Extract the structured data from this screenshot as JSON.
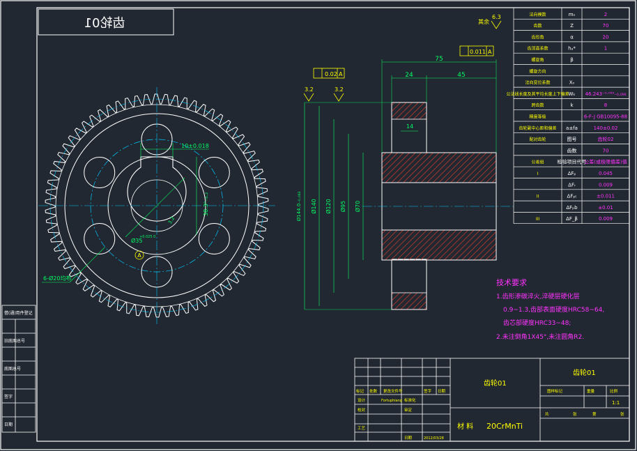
{
  "drawing": {
    "mirrored_title": "齿轮01",
    "colors": {
      "background": "#222831",
      "line": "#ffffff",
      "center_line": "#00c8ff",
      "dimension": "#00ff66",
      "hatch": "#c0392b",
      "text_yellow": "#ffff00",
      "text_magenta": "#ff33ff"
    },
    "front_view": {
      "keyway_width": "10±0.018",
      "keyway_depth": "38.3⁰₋₀.₂",
      "bore_dia": "Ø35",
      "bore_tol": "+0.025 0",
      "dim_small": "3.2",
      "holes_note": "6-Ø20均布",
      "datum": "A"
    },
    "section_view": {
      "length_total": "75",
      "length_hub": "24",
      "length_rim": "45",
      "width_web": "14",
      "dia_tip": "Ø144.0₋₀.₀₆₃",
      "dia_140": "Ø140",
      "dia_120": "Ø120",
      "dia_95": "Ø95",
      "dia_70": "Ø70",
      "roughness_1": "3.2",
      "roughness_2": "3.2",
      "roughness_corner": "6.3",
      "roughness_rest": "其余",
      "tol_box_1": "0.02",
      "tol_box_1_datum": "A",
      "tol_box_2": "0.011",
      "tol_box_2_datum": "A"
    },
    "param_table": [
      {
        "name": "法向模数",
        "sym": "mₙ",
        "val": "2"
      },
      {
        "name": "齿数",
        "sym": "Z",
        "val": "70"
      },
      {
        "name": "齿形角",
        "sym": "α",
        "val": "20"
      },
      {
        "name": "齿顶高系数",
        "sym": "hₐ*",
        "val": "1"
      },
      {
        "name": "螺旋角",
        "sym": "β",
        "val": ""
      },
      {
        "name": "螺旋方向",
        "sym": "",
        "val": ""
      },
      {
        "name": "法向变位系数",
        "sym": "Xₙ",
        "val": ""
      },
      {
        "name": "公法线长度及其平均长度上下偏差",
        "sym": "Wₖ",
        "val": "46.243⁻⁰·⁰⁵⁹₋₀.₀₉₆"
      },
      {
        "name": "跨齿数",
        "sym": "k",
        "val": "8"
      },
      {
        "name": "精度等级",
        "sym": "",
        "val": "6-F-J GB10095-88"
      },
      {
        "name": "齿轮副中心距和偏差",
        "sym": "a±fa",
        "val": "140±0.02"
      },
      {
        "name": "配对齿轮",
        "sym": "图号",
        "val": "齿轮02"
      },
      {
        "name": "",
        "sym": "齿数",
        "val": "70"
      },
      {
        "name": "公差组",
        "sym": "检验项目代号",
        "val": "公差(或极限偏差)值"
      },
      {
        "name": "I",
        "sym": "ΔFₚ",
        "val": "0.045"
      },
      {
        "name": "",
        "sym": "ΔFᵣ",
        "val": "0.009"
      },
      {
        "name": "II",
        "sym": "ΔFₚₜ",
        "val": "±0.011"
      },
      {
        "name": "",
        "sym": "ΔFₚb",
        "val": "±0.01"
      },
      {
        "name": "III",
        "sym": "ΔF_β",
        "val": "0.009"
      }
    ],
    "tech_req": {
      "title": "技术要求",
      "line1": "1.齿形渗碳淬火,淬硬层硬化层",
      "line2": "0.9~1.3,齿部表面硬度HRC58~64,",
      "line3": "齿芯部硬度HRC33~48;",
      "line4": "2.未注倒角1X45°,未注圆角R2."
    },
    "title_block": {
      "part_name": "齿轮01",
      "part_name_right": "齿轮01",
      "material_label": "材  料",
      "material": "20CrMnTi",
      "rev_headers": [
        "标记",
        "处数",
        "更改文件号",
        "签字",
        "日期"
      ],
      "designer_label": "设计",
      "designer": "Fortuphiang",
      "standard_label": "标准化",
      "check_label": "校对",
      "review_label": "审定",
      "process_label": "工艺",
      "date_label": "日期",
      "date": "2012/03/28",
      "stage_label": "图样标记",
      "weight_label": "重量",
      "scale_label": "比例",
      "scale": "1:1",
      "sheets_total": "共",
      "sheet_label": "张",
      "sheet_no": "第",
      "sheet_label2": "张"
    },
    "left_strip": [
      "借(通)用件登记",
      "旧底图总号",
      "底图总号",
      "签字",
      "日期"
    ]
  }
}
